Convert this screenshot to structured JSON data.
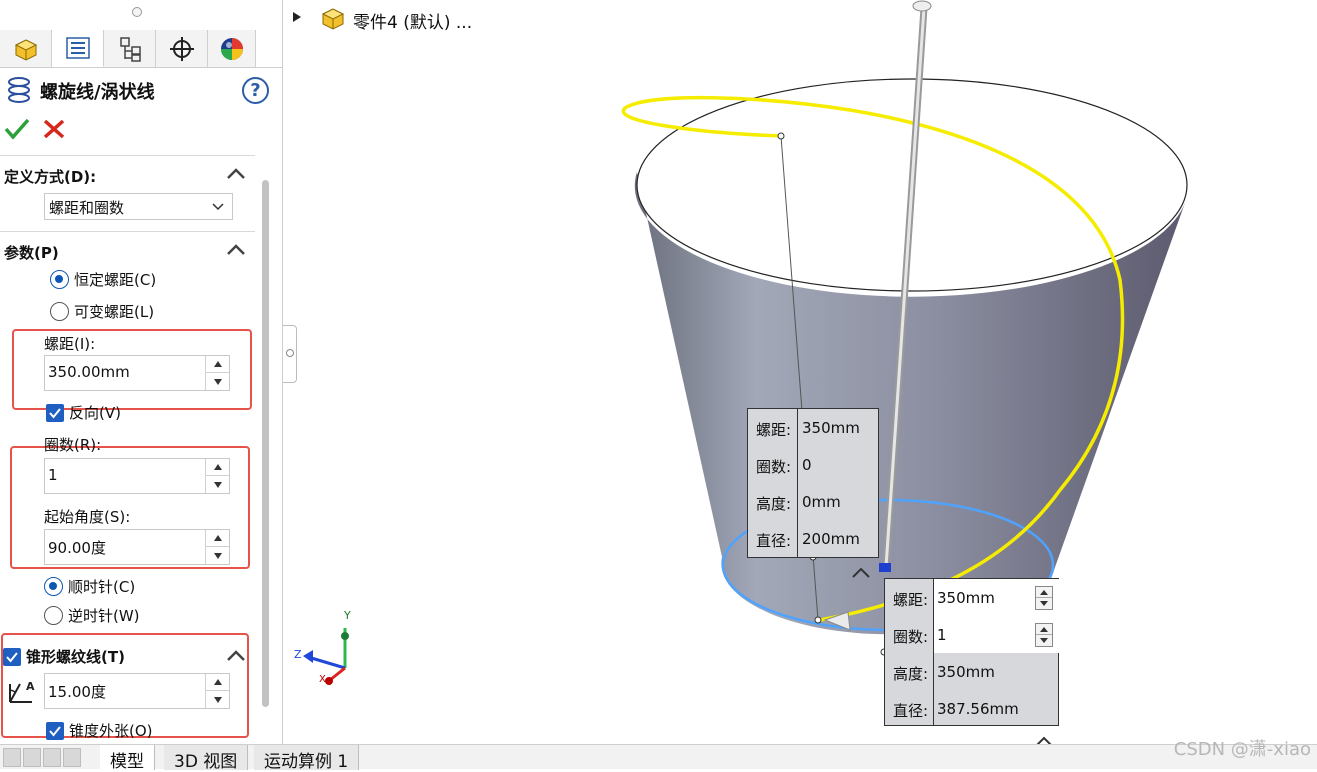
{
  "panel": {
    "title": "螺旋线/涡状线",
    "help_symbol": "?",
    "definition": {
      "header": "定义方式(D):",
      "selected": "螺距和圈数"
    },
    "parameters": {
      "header": "参数(P)",
      "constant_pitch": "恒定螺距(C)",
      "variable_pitch": "可变螺距(L)",
      "pitch_label": "螺距(I):",
      "pitch_value": "350.00mm",
      "reverse_label": "反向(V)",
      "revolutions_label": "圈数(R):",
      "revolutions_value": "1",
      "start_angle_label": "起始角度(S):",
      "start_angle_value": "90.00度",
      "clockwise": "顺时针(C)",
      "counterclockwise": "逆时针(W)"
    },
    "taper": {
      "header": "锥形螺纹线(T)",
      "angle_value": "15.00度",
      "outward_label": "锥度外张(O)"
    }
  },
  "viewport": {
    "part_label": "零件4 (默认) ...",
    "triad": {
      "x": "X",
      "y": "Y",
      "z": "Z"
    },
    "callout_start": [
      {
        "key": "螺距:",
        "value": "350mm"
      },
      {
        "key": "圈数:",
        "value": "0"
      },
      {
        "key": "高度:",
        "value": "0mm"
      },
      {
        "key": "直径:",
        "value": "200mm"
      }
    ],
    "callout_end": [
      {
        "key": "螺距:",
        "value": "350mm"
      },
      {
        "key": "圈数:",
        "value": "1"
      },
      {
        "key": "高度:",
        "value": "350mm"
      },
      {
        "key": "直径:",
        "value": "387.56mm"
      }
    ]
  },
  "bottom_tabs": [
    "模型",
    "3D 视图",
    "运动算例 1"
  ],
  "watermark": "CSDN @潇-xiao",
  "colors": {
    "helix": "#f5ec00",
    "base_circle": "#4ea3ff",
    "accent_blue": "#0b57b3",
    "highlight_red": "#e5534b",
    "accept_green": "#2ba13a",
    "cancel_red": "#d6271d"
  }
}
